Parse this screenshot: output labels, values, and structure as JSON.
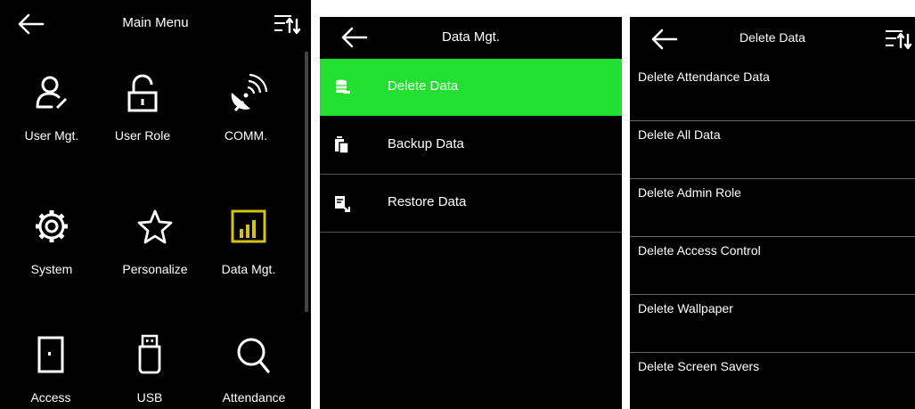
{
  "main_menu": {
    "title": "Main Menu",
    "items": [
      {
        "label": "User Mgt.",
        "icon": "user-icon"
      },
      {
        "label": "User Role",
        "icon": "lock-icon"
      },
      {
        "label": "COMM.",
        "icon": "satellite-dish-icon"
      },
      {
        "label": "System",
        "icon": "gear-icon"
      },
      {
        "label": "Personalize",
        "icon": "star-icon"
      },
      {
        "label": "Data Mgt.",
        "icon": "bar-chart-icon"
      },
      {
        "label": "Access",
        "icon": "door-icon"
      },
      {
        "label": "USB",
        "icon": "usb-drive-icon"
      },
      {
        "label": "Attendance",
        "icon": "search-icon"
      }
    ]
  },
  "data_mgt": {
    "title": "Data Mgt.",
    "items": [
      {
        "label": "Delete Data",
        "icon": "delete-database-icon",
        "selected": true
      },
      {
        "label": "Backup Data",
        "icon": "backup-icon",
        "selected": false
      },
      {
        "label": "Restore Data",
        "icon": "restore-icon",
        "selected": false
      }
    ]
  },
  "delete_data": {
    "title": "Delete Data",
    "items": [
      {
        "label": "Delete Attendance Data"
      },
      {
        "label": "Delete All Data"
      },
      {
        "label": "Delete Admin Role"
      },
      {
        "label": "Delete Access Control"
      },
      {
        "label": "Delete Wallpaper"
      },
      {
        "label": "Delete Screen Savers"
      }
    ]
  },
  "colors": {
    "background": "#000000",
    "selected": "#22e030",
    "accent_icon": "#d4c21a",
    "text": "#ffffff"
  }
}
